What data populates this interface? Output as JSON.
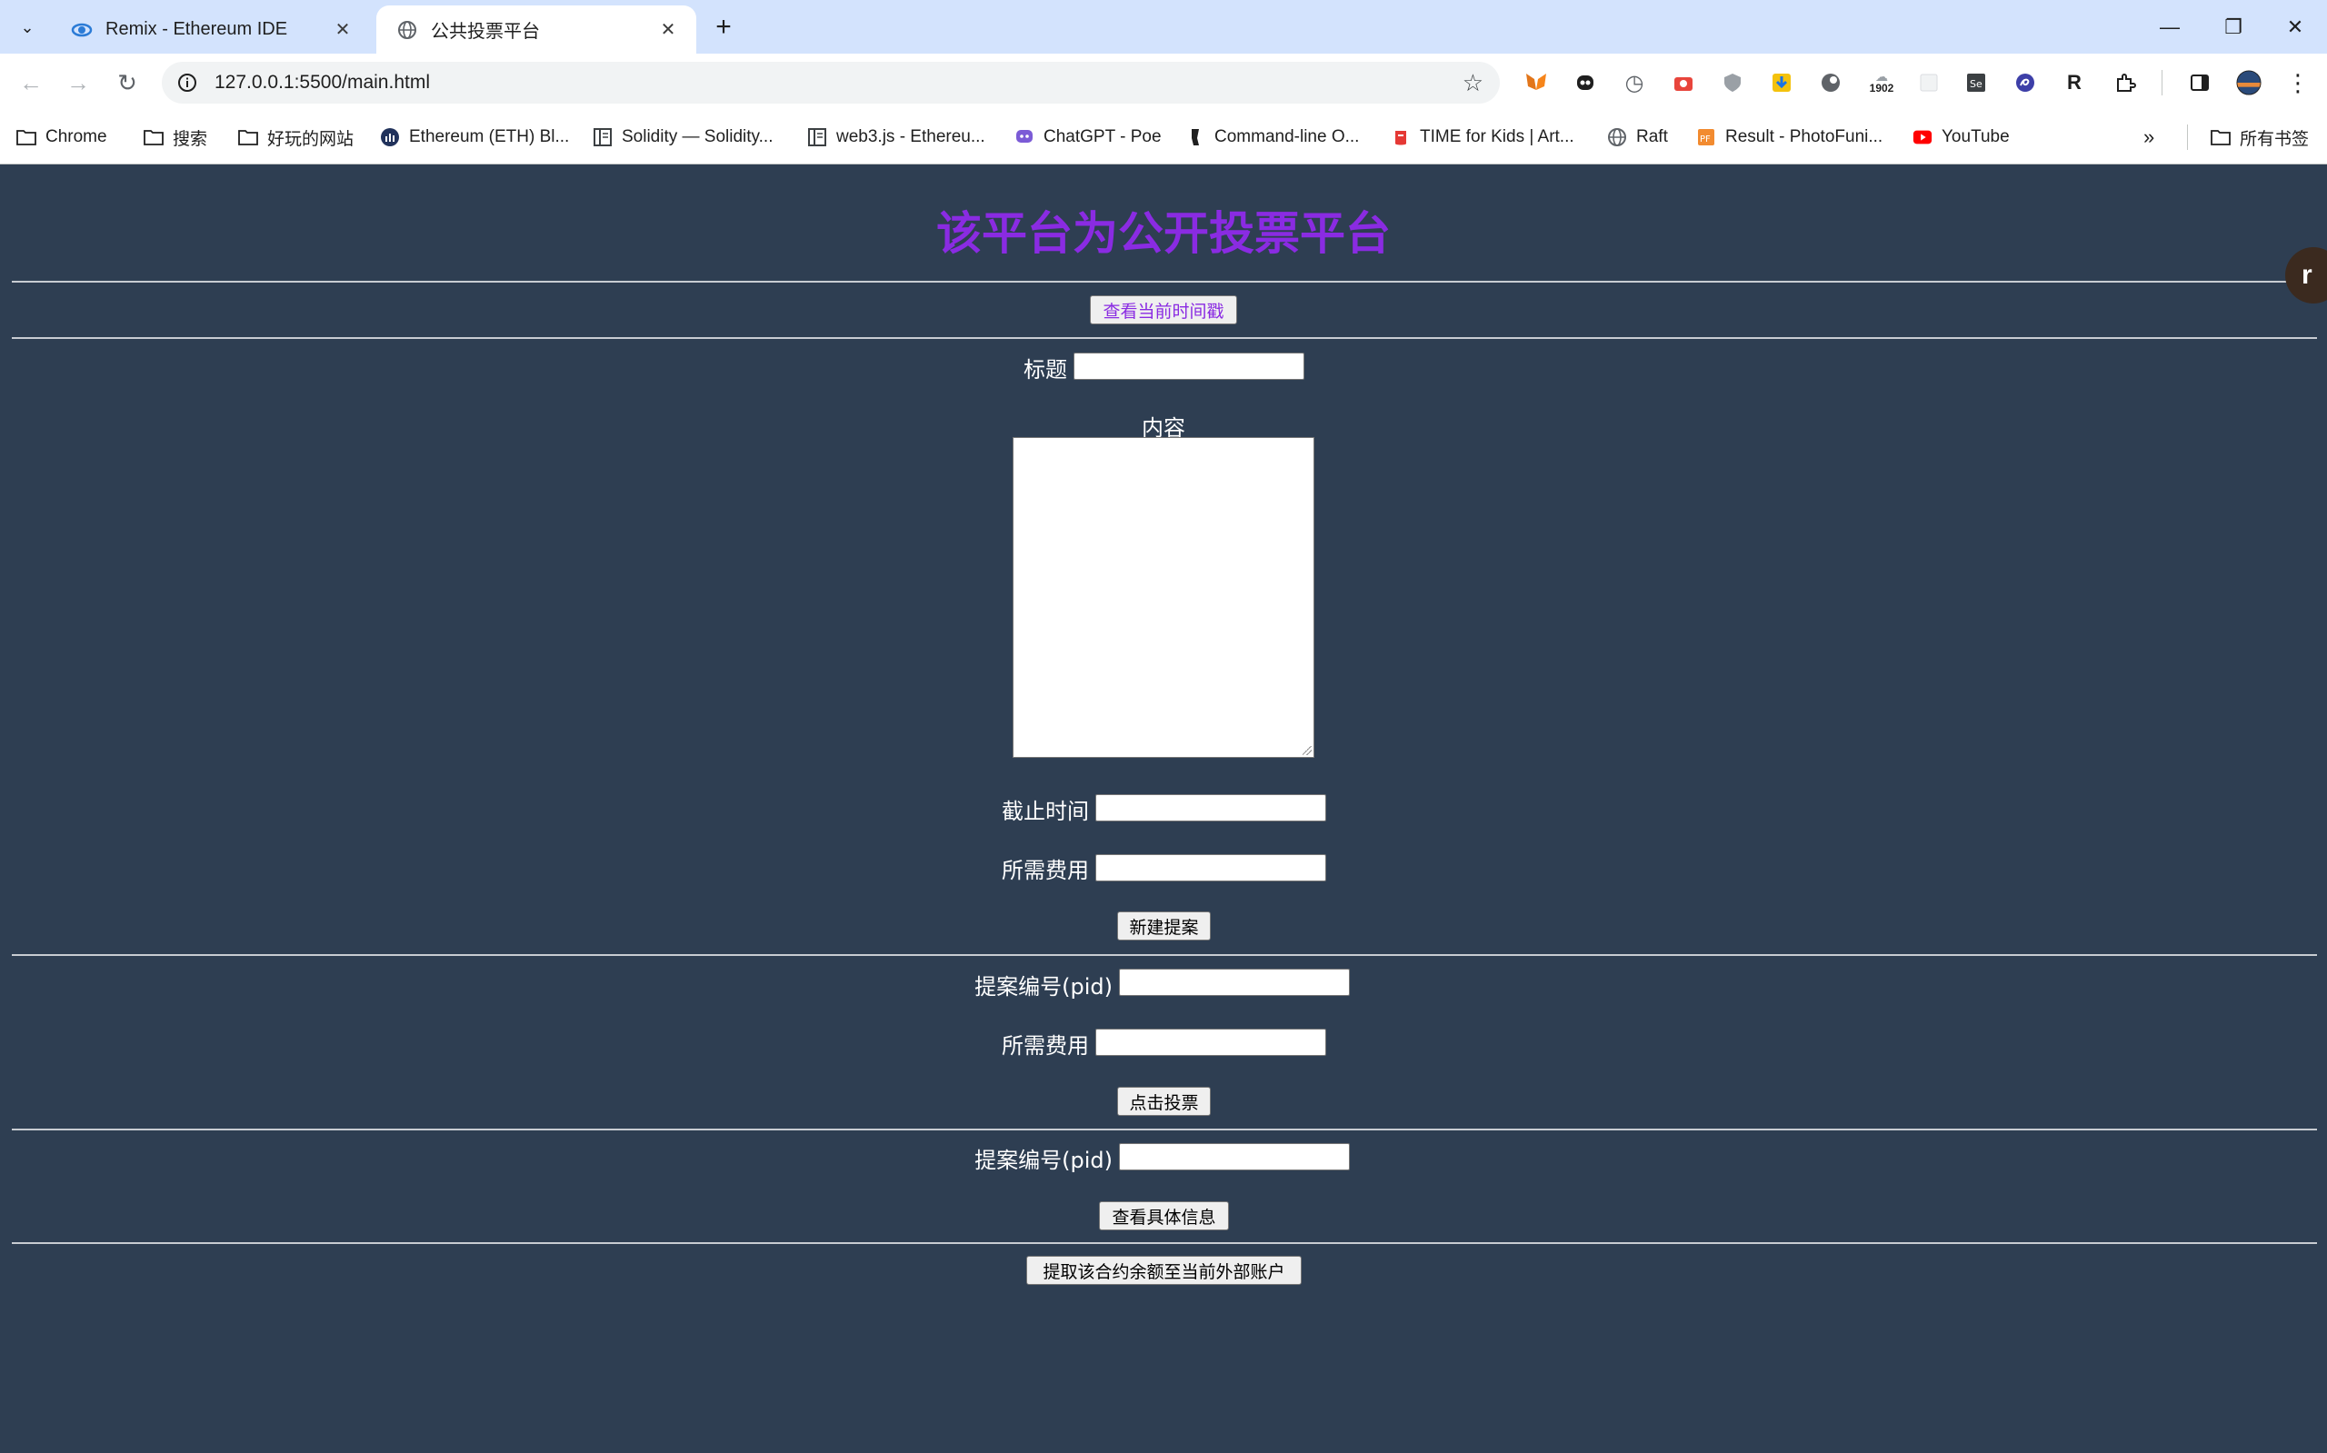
{
  "browser": {
    "tabs": [
      {
        "title": "Remix - Ethereum IDE",
        "icon": "remix-icon",
        "active": false
      },
      {
        "title": "公共投票平台",
        "icon": "globe-icon",
        "active": true
      }
    ],
    "url": "127.0.0.1:5500/main.html",
    "extensions": {
      "badge_count": "1902"
    },
    "bookmarks": [
      {
        "label": "Chrome",
        "icon": "folder-icon"
      },
      {
        "label": "搜索",
        "icon": "folder-icon"
      },
      {
        "label": "好玩的网站",
        "icon": "folder-icon"
      },
      {
        "label": "Ethereum (ETH) Bl...",
        "icon": "etherscan-icon"
      },
      {
        "label": "Solidity — Solidity...",
        "icon": "docs-icon"
      },
      {
        "label": "web3.js - Ethereu...",
        "icon": "docs-icon"
      },
      {
        "label": "ChatGPT - Poe",
        "icon": "poe-icon"
      },
      {
        "label": "Command-line O...",
        "icon": "command-icon"
      },
      {
        "label": "TIME for Kids | Art...",
        "icon": "time-icon"
      },
      {
        "label": "Raft",
        "icon": "globe-icon"
      },
      {
        "label": "Result - PhotoFuni...",
        "icon": "photofunia-icon"
      },
      {
        "label": "YouTube",
        "icon": "youtube-icon"
      }
    ],
    "all_bookmarks": "所有书签"
  },
  "page": {
    "title": "该平台为公开投票平台",
    "timestamp_button": "查看当前时间戳",
    "create": {
      "title_label": "标题",
      "content_label": "内容",
      "deadline_label": "截止时间",
      "fee_label": "所需费用",
      "submit_button": "新建提案"
    },
    "vote": {
      "pid_label": "提案编号(pid)",
      "fee_label": "所需费用",
      "submit_button": "点击投票"
    },
    "info": {
      "pid_label": "提案编号(pid)",
      "submit_button": "查看具体信息"
    },
    "withdraw_button": "提取该合约余额至当前外部账户",
    "floating_button_letter": "r"
  },
  "colors": {
    "page_bg": "#2e3e52",
    "title": "#8a2be2",
    "tabstrip": "#d3e3fd"
  }
}
